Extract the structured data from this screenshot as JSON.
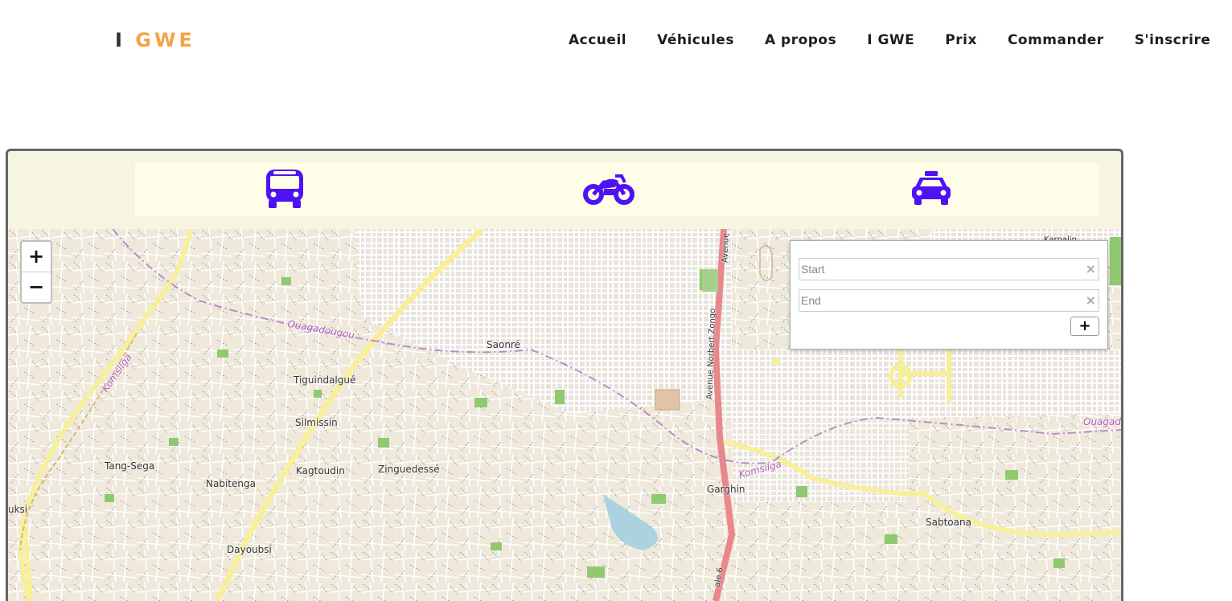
{
  "header": {
    "logo_i": "I",
    "logo_gwe": "GWE",
    "nav": [
      "Accueil",
      "Véhicules",
      "A propos",
      "I GWE",
      "Prix",
      "Commander",
      "S'inscrire"
    ]
  },
  "vehicles": [
    {
      "name": "bus-icon"
    },
    {
      "name": "motorcycle-icon"
    },
    {
      "name": "taxi-icon"
    }
  ],
  "colors": {
    "vehicle_icon": "#4f12f5",
    "logo_orange": "#f3a447"
  },
  "map": {
    "zoom_in": "+",
    "zoom_out": "−",
    "routing": {
      "start_placeholder": "Start",
      "end_placeholder": "End",
      "clear": "×",
      "add": "+"
    },
    "labels": {
      "saonre": "Saonré",
      "tiguindalgue": "Tiguindalgué",
      "silmissin": "Silmissin",
      "kagtoudin": "Kagtoudin",
      "zinguedesse": "Zinguedessé",
      "tang_sega": "Tang-Sega",
      "nabitenga": "Nabitenga",
      "dayoubsi": "Dayoubsi",
      "garghin": "Garghin",
      "sabtoana": "Sabtoana",
      "uksi": "uksi",
      "ouaga_1": "Ouagadougou",
      "ouaga_2": "Ouagad",
      "komsilga_1": "Komsilga",
      "komsilga_2": "Komsilga",
      "avenue": "Avenue Norbert Zongo",
      "avenue_top": "Avenue",
      "karpalin": "Karpalin",
      "ale6": "ale 6"
    }
  }
}
